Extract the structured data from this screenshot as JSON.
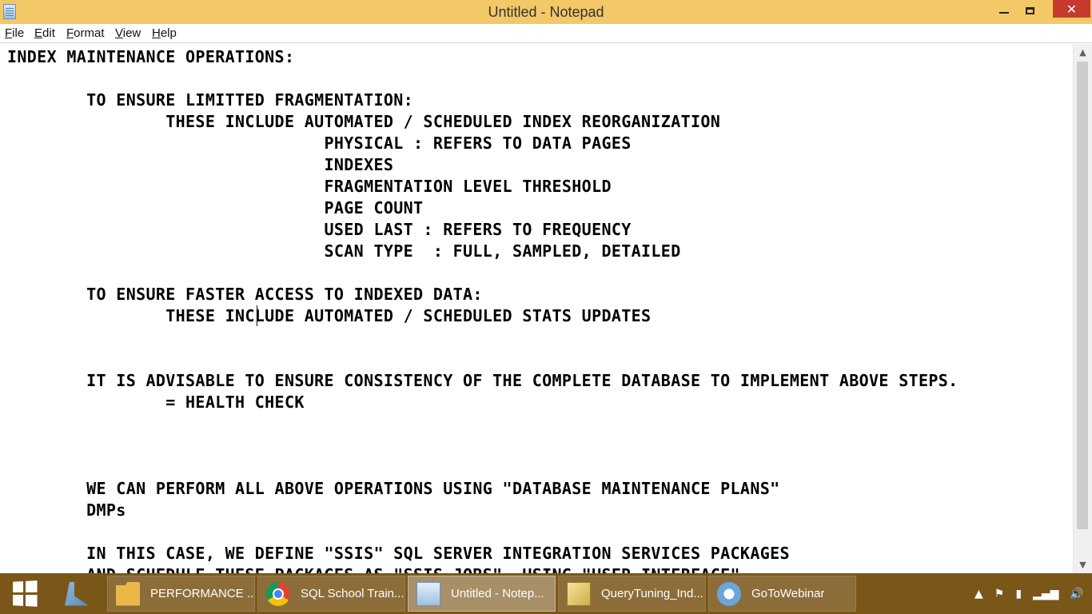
{
  "window": {
    "title": "Untitled - Notepad",
    "close_glyph": "✕"
  },
  "menu": {
    "items": [
      "File",
      "Edit",
      "Format",
      "View",
      "Help"
    ]
  },
  "editor": {
    "content": "INDEX MAINTENANCE OPERATIONS:\n\n        TO ENSURE LIMITTED FRAGMENTATION:\n                THESE INCLUDE AUTOMATED / SCHEDULED INDEX REORGANIZATION\n                                PHYSICAL : REFERS TO DATA PAGES\n                                INDEXES\n                                FRAGMENTATION LEVEL THRESHOLD\n                                PAGE COUNT\n                                USED LAST : REFERS TO FREQUENCY\n                                SCAN TYPE  : FULL, SAMPLED, DETAILED\n\n        TO ENSURE FASTER ACCESS TO INDEXED DATA:\n                THESE INCLUDE AUTOMATED / SCHEDULED STATS UPDATES\n\n\n        IT IS ADVISABLE TO ENSURE CONSISTENCY OF THE COMPLETE DATABASE TO IMPLEMENT ABOVE STEPS.\n                = HEALTH CHECK\n\n\n\n        WE CAN PERFORM ALL ABOVE OPERATIONS USING \"DATABASE MAINTENANCE PLANS\"\n        DMPs\n\n        IN THIS CASE, WE DEFINE \"SSIS\" SQL SERVER INTEGRATION SERVICES PACKAGES\n        AND SCHEDULE THESE PACKAGES AS \"SSIS JOBS\". USING \"USER INTERFACE\""
  },
  "scrollbar": {
    "up_glyph": "▲",
    "down_glyph": "▼"
  },
  "taskbar": {
    "buttons": [
      {
        "label": "PERFORMANCE ...",
        "icon": "folder-icon"
      },
      {
        "label": "SQL School Train...",
        "icon": "chrome-icon"
      },
      {
        "label": "Untitled - Notep...",
        "icon": "notepad-icon"
      },
      {
        "label": "QueryTuning_Ind...",
        "icon": "sql-file-icon"
      },
      {
        "label": "GoToWebinar",
        "icon": "gotowebinar-icon"
      }
    ],
    "tray": {
      "chevron": "▲",
      "flag": "⚑",
      "battery": "▮",
      "signal": "▂▄▆",
      "volume": "🔊"
    }
  }
}
